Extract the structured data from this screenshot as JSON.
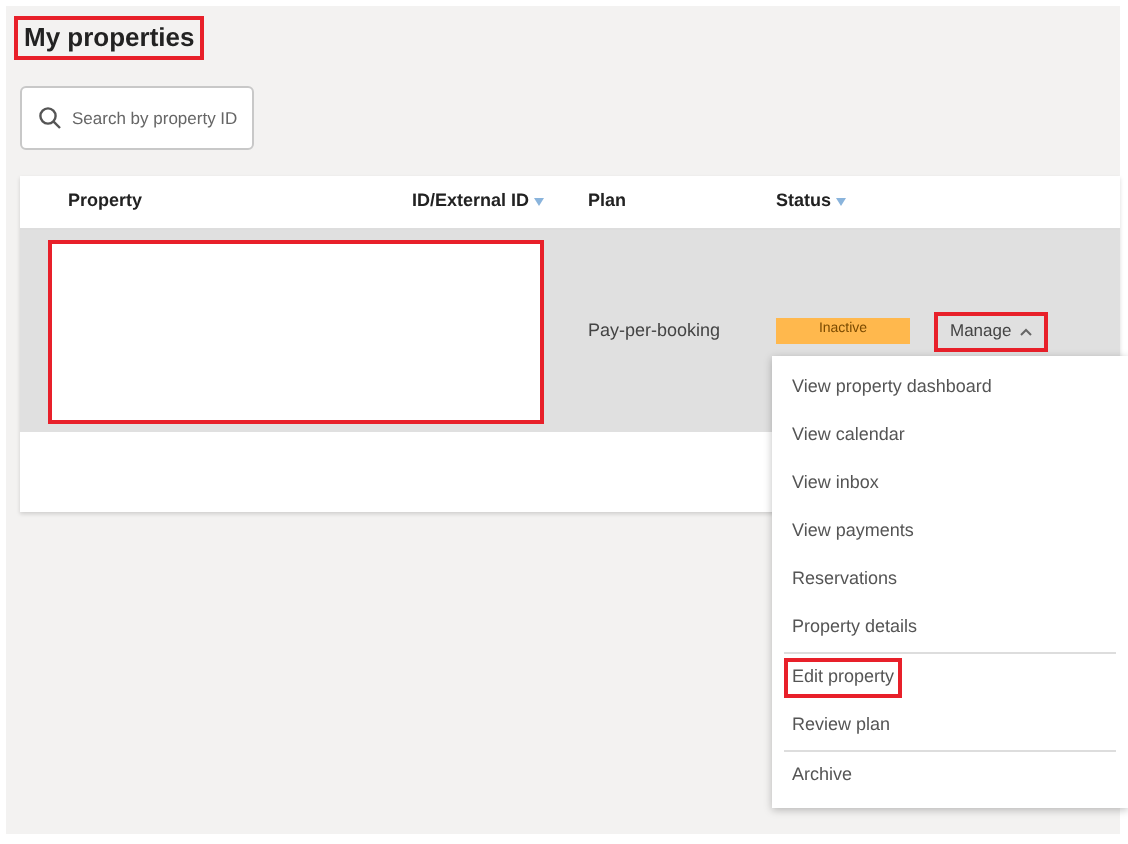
{
  "title": {
    "text": "My properties",
    "highlighted": true
  },
  "search": {
    "placeholder": "Search by property ID"
  },
  "table": {
    "columns": [
      {
        "label": "Property",
        "sortable": false
      },
      {
        "label": "ID/External ID",
        "sortable": true
      },
      {
        "label": "Plan",
        "sortable": false
      },
      {
        "label": "Status",
        "sortable": true
      }
    ],
    "rows": [
      {
        "property_redacted": true,
        "plan": "Pay-per-booking",
        "status": {
          "label": "Inactive",
          "color": "#ffb84d"
        },
        "action": {
          "label": "Manage",
          "highlighted": true,
          "expanded": true
        }
      }
    ]
  },
  "menu": {
    "items": [
      {
        "kind": "item",
        "label": "View property dashboard",
        "highlighted": false
      },
      {
        "kind": "item",
        "label": "View calendar",
        "highlighted": false
      },
      {
        "kind": "item",
        "label": "View inbox",
        "highlighted": false
      },
      {
        "kind": "item",
        "label": "View payments",
        "highlighted": false
      },
      {
        "kind": "item",
        "label": "Reservations",
        "highlighted": false
      },
      {
        "kind": "item",
        "label": "Property details",
        "highlighted": false
      },
      {
        "kind": "divider"
      },
      {
        "kind": "item",
        "label": "Edit property",
        "highlighted": true
      },
      {
        "kind": "item",
        "label": "Review plan",
        "highlighted": false
      },
      {
        "kind": "divider"
      },
      {
        "kind": "item",
        "label": "Archive",
        "highlighted": false
      }
    ]
  }
}
